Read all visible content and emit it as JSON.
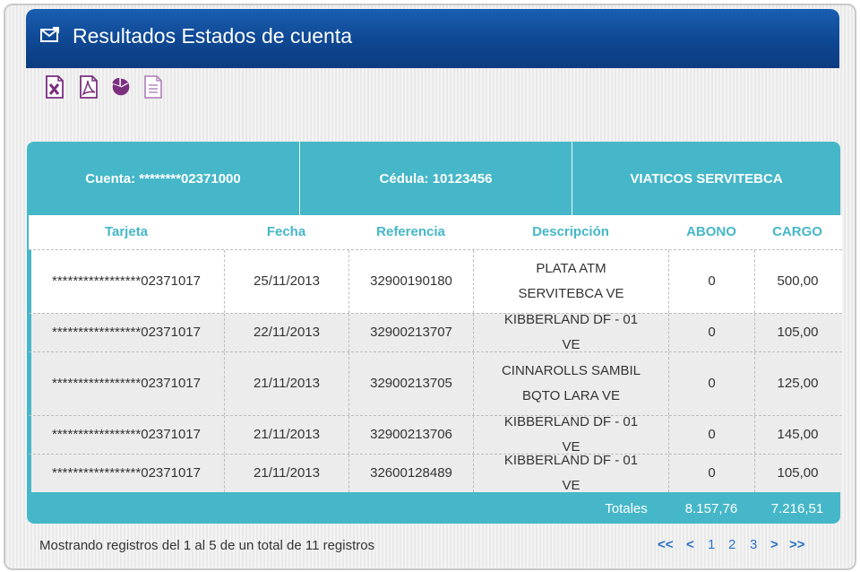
{
  "header": {
    "title": "Resultados Estados de cuenta",
    "icon": "mail-icon"
  },
  "toolbar": [
    {
      "name": "excel-export-icon",
      "color": "#7b2f7f"
    },
    {
      "name": "pdf-export-icon",
      "color": "#7b2f7f"
    },
    {
      "name": "pie-chart-icon",
      "color": "#7b2f7f"
    },
    {
      "name": "document-icon",
      "color": "#b58ac0"
    }
  ],
  "account": {
    "cuenta": "Cuenta: ********02371000",
    "cedula": "Cédula: 10123456",
    "name": "VIATICOS SERVITEBCA"
  },
  "table": {
    "columns": [
      "Tarjeta",
      "Fecha",
      "Referencia",
      "Descripción",
      "ABONO",
      "CARGO"
    ],
    "rows": [
      [
        "*****************02371017",
        "25/11/2013",
        "32900190180",
        "PLATA ATM SERVITEBCA VE",
        "0",
        "500,00"
      ],
      [
        "*****************02371017",
        "22/11/2013",
        "32900213707",
        "KIBBERLAND DF - 01 VE",
        "0",
        "105,00"
      ],
      [
        "*****************02371017",
        "21/11/2013",
        "32900213705",
        "CINNAROLLS SAMBIL BQTO LARA VE",
        "0",
        "125,00"
      ],
      [
        "*****************02371017",
        "21/11/2013",
        "32900213706",
        "KIBBERLAND DF - 01 VE",
        "0",
        "145,00"
      ],
      [
        "*****************02371017",
        "21/11/2013",
        "32600128489",
        "KIBBERLAND DF - 01 VE",
        "0",
        "105,00"
      ]
    ],
    "totals": {
      "label": "Totales",
      "abono": "8.157,76",
      "cargo": "7.216,51"
    }
  },
  "footer": {
    "info": "Mostrando registros del 1 al 5 de un total de 11 registros",
    "pager": {
      "first": "<<",
      "prev": "<",
      "pages": [
        "1",
        "2",
        "3"
      ],
      "next": ">",
      "last": ">>"
    }
  },
  "colors": {
    "accent": "#45b7c8",
    "header": "#0e4792",
    "link": "#2a72c8"
  }
}
